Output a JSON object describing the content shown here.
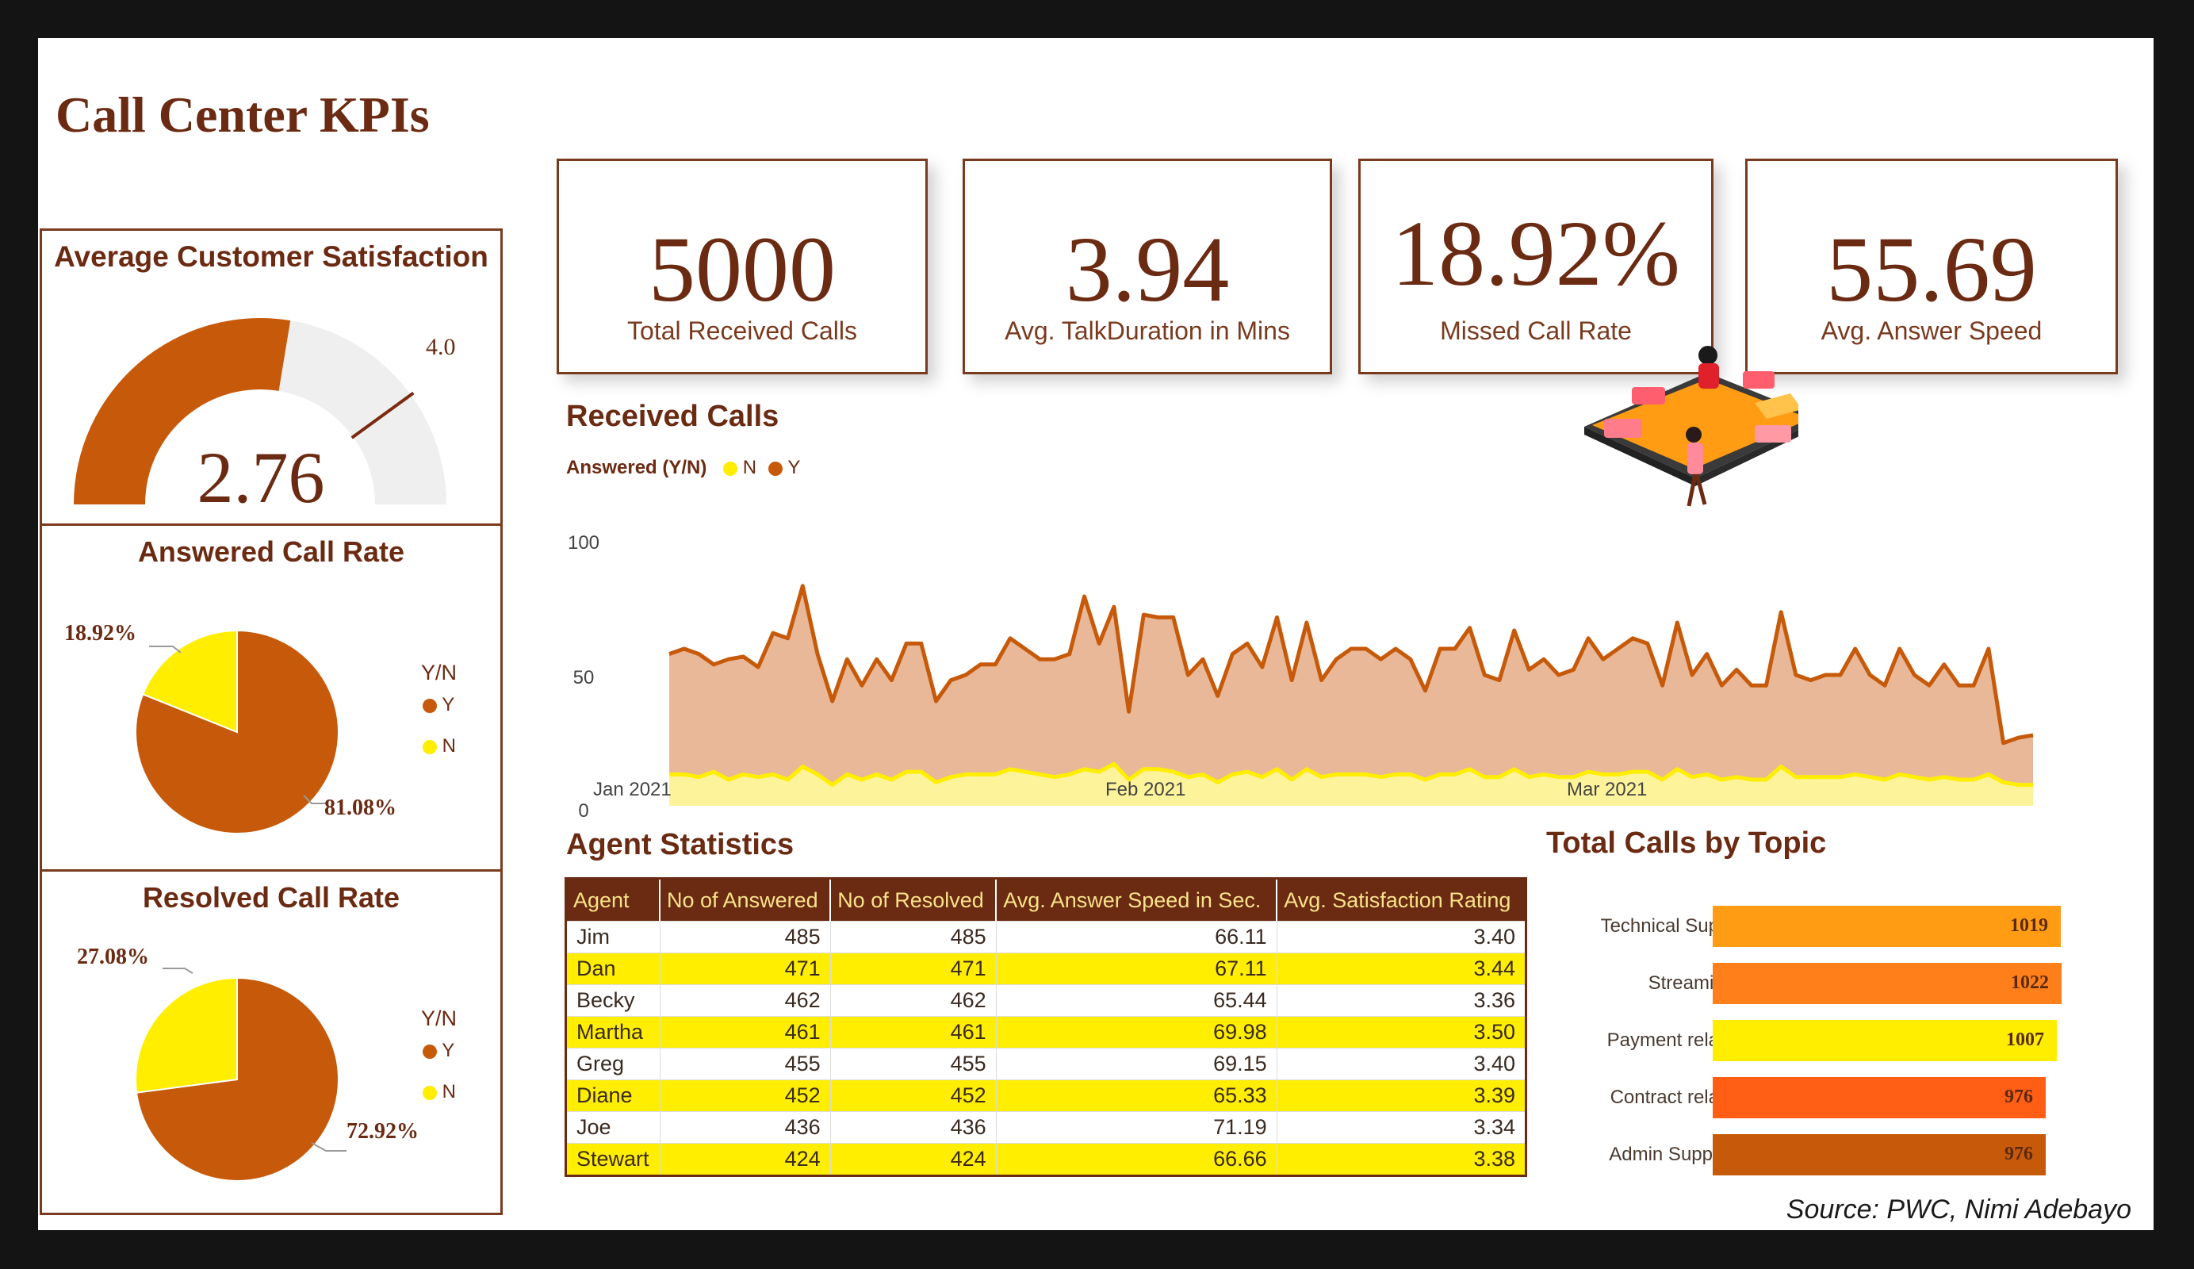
{
  "title": "Call Center KPIs",
  "kpis": [
    {
      "value": "5000",
      "label": "Total Received Calls"
    },
    {
      "value": "3.94",
      "label": "Avg. TalkDuration in Mins"
    },
    {
      "value": "18.92%",
      "label": "Missed Call Rate"
    },
    {
      "value": "55.69",
      "label": "Avg. Answer Speed"
    }
  ],
  "satisfaction": {
    "title": "Average Customer Satisfaction",
    "value": "2.76",
    "target": "4.0",
    "min": "0",
    "max": "5"
  },
  "answered": {
    "title": "Answered Call Rate",
    "legend_title": "Y/N",
    "legend_y": "Y",
    "legend_n": "N",
    "label_n": "18.92%",
    "label_y": "81.08%"
  },
  "resolved": {
    "title": "Resolved Call Rate",
    "legend_title": "Y/N",
    "legend_y": "Y",
    "legend_n": "N",
    "label_n": "27.08%",
    "label_y": "72.92%"
  },
  "received_calls": {
    "title": "Received Calls",
    "legend_title": "Answered (Y/N)",
    "legend_n": "N",
    "legend_y": "Y",
    "y_ticks": [
      "0",
      "50",
      "100"
    ],
    "x_ticks": [
      "Jan 2021",
      "Feb 2021",
      "Mar 2021"
    ]
  },
  "agents": {
    "title": "Agent Statistics",
    "columns": [
      "Agent",
      "No of Answered",
      "No of Resolved",
      "Avg. Answer Speed in Sec.",
      "Avg. Satisfaction Rating"
    ],
    "rows": [
      [
        "Jim",
        "485",
        "485",
        "66.11",
        "3.40"
      ],
      [
        "Dan",
        "471",
        "471",
        "67.11",
        "3.44"
      ],
      [
        "Becky",
        "462",
        "462",
        "65.44",
        "3.36"
      ],
      [
        "Martha",
        "461",
        "461",
        "69.98",
        "3.50"
      ],
      [
        "Greg",
        "455",
        "455",
        "69.15",
        "3.40"
      ],
      [
        "Diane",
        "452",
        "452",
        "65.33",
        "3.39"
      ],
      [
        "Joe",
        "436",
        "436",
        "71.19",
        "3.34"
      ],
      [
        "Stewart",
        "424",
        "424",
        "66.66",
        "3.38"
      ]
    ]
  },
  "topics": {
    "title": "Total Calls by Topic",
    "bars": [
      {
        "label": "Technical Sup...",
        "value": "1019",
        "color": "#ff9c14"
      },
      {
        "label": "Streaming",
        "value": "1022",
        "color": "#ff7f1a"
      },
      {
        "label": "Payment rela...",
        "value": "1007",
        "color": "#ffee00"
      },
      {
        "label": "Contract rela...",
        "value": "976",
        "color": "#ff5e14"
      },
      {
        "label": "Admin Support",
        "value": "976",
        "color": "#c75a0a"
      }
    ]
  },
  "source": "Source: PWC, Nimi Adebayo",
  "colors": {
    "accent": "#c75a0a",
    "maroon": "#6b2a12",
    "yellow": "#ffee00",
    "area_y": "#e8b898",
    "area_n": "#fdf39a"
  },
  "chart_data": [
    {
      "type": "area",
      "title": "Received Calls",
      "legend": [
        "N",
        "Y"
      ],
      "ylim": [
        0,
        100
      ],
      "x": [
        "2021-01-01",
        "2021-01-02",
        "2021-01-03",
        "2021-01-04",
        "2021-01-05",
        "2021-01-06",
        "2021-01-07",
        "2021-01-08",
        "2021-01-09",
        "2021-01-10",
        "2021-01-11",
        "2021-01-12",
        "2021-01-13",
        "2021-01-14",
        "2021-01-15",
        "2021-01-16",
        "2021-01-17",
        "2021-01-18",
        "2021-01-19",
        "2021-01-20",
        "2021-01-21",
        "2021-01-22",
        "2021-01-23",
        "2021-01-24",
        "2021-01-25",
        "2021-01-26",
        "2021-01-27",
        "2021-01-28",
        "2021-01-29",
        "2021-01-30",
        "2021-01-31",
        "2021-02-01",
        "2021-02-02",
        "2021-02-03",
        "2021-02-04",
        "2021-02-05",
        "2021-02-06",
        "2021-02-07",
        "2021-02-08",
        "2021-02-09",
        "2021-02-10",
        "2021-02-11",
        "2021-02-12",
        "2021-02-13",
        "2021-02-14",
        "2021-02-15",
        "2021-02-16",
        "2021-02-17",
        "2021-02-18",
        "2021-02-19",
        "2021-02-20",
        "2021-02-21",
        "2021-02-22",
        "2021-02-23",
        "2021-02-24",
        "2021-02-25",
        "2021-02-26",
        "2021-02-27",
        "2021-02-28",
        "2021-03-01",
        "2021-03-02",
        "2021-03-03",
        "2021-03-04",
        "2021-03-05",
        "2021-03-06",
        "2021-03-07",
        "2021-03-08",
        "2021-03-09",
        "2021-03-10",
        "2021-03-11",
        "2021-03-12",
        "2021-03-13",
        "2021-03-14",
        "2021-03-15",
        "2021-03-16",
        "2021-03-17",
        "2021-03-18",
        "2021-03-19",
        "2021-03-20",
        "2021-03-21",
        "2021-03-22",
        "2021-03-23",
        "2021-03-24",
        "2021-03-25",
        "2021-03-26",
        "2021-03-27",
        "2021-03-28",
        "2021-03-29",
        "2021-03-30",
        "2021-03-31"
      ],
      "series": [
        {
          "name": "Y",
          "values": [
            58,
            60,
            58,
            54,
            56,
            57,
            53,
            66,
            64,
            84,
            58,
            40,
            56,
            46,
            56,
            48,
            62,
            62,
            40,
            48,
            50,
            54,
            54,
            64,
            60,
            56,
            56,
            58,
            80,
            62,
            76,
            36,
            73,
            72,
            72,
            50,
            56,
            42,
            58,
            62,
            53,
            72,
            48,
            70,
            48,
            56,
            60,
            60,
            56,
            60,
            56,
            44,
            60,
            60,
            68,
            50,
            48,
            67,
            52,
            56,
            50,
            52,
            64,
            56,
            60,
            64,
            62,
            46,
            70,
            50,
            58,
            46,
            52,
            46,
            46,
            74,
            50,
            48,
            50,
            50,
            60,
            50,
            46,
            60,
            50,
            46,
            54,
            46,
            46,
            60,
            24,
            26,
            27
          ]
        },
        {
          "name": "N",
          "values": [
            12,
            12,
            11,
            13,
            10,
            12,
            11,
            12,
            10,
            15,
            12,
            8,
            12,
            10,
            12,
            10,
            13,
            13,
            9,
            11,
            12,
            12,
            12,
            14,
            13,
            12,
            11,
            12,
            14,
            13,
            16,
            10,
            14,
            14,
            13,
            11,
            12,
            9,
            12,
            13,
            11,
            14,
            10,
            14,
            11,
            12,
            12,
            12,
            11,
            12,
            12,
            10,
            12,
            12,
            14,
            11,
            11,
            14,
            11,
            12,
            11,
            11,
            13,
            12,
            12,
            13,
            13,
            10,
            14,
            11,
            12,
            10,
            11,
            10,
            10,
            15,
            11,
            11,
            11,
            11,
            12,
            11,
            10,
            12,
            11,
            10,
            11,
            10,
            10,
            12,
            9,
            8,
            8
          ]
        }
      ]
    },
    {
      "type": "pie",
      "title": "Answered Call Rate",
      "legend": [
        "Y",
        "N"
      ],
      "values": [
        81.08,
        18.92
      ],
      "categories": [
        "Y",
        "N"
      ]
    },
    {
      "type": "pie",
      "title": "Resolved Call Rate",
      "legend": [
        "Y",
        "N"
      ],
      "values": [
        72.92,
        27.08
      ],
      "categories": [
        "Y",
        "N"
      ]
    },
    {
      "type": "bar",
      "title": "Total Calls by Topic",
      "categories": [
        "Technical Sup...",
        "Streaming",
        "Payment rela...",
        "Contract rela...",
        "Admin Support"
      ],
      "values": [
        1019,
        1022,
        1007,
        976,
        976
      ]
    },
    {
      "type": "gauge",
      "title": "Average Customer Satisfaction",
      "value": 2.76,
      "target": 4.0,
      "ylim": [
        0,
        5
      ]
    }
  ]
}
